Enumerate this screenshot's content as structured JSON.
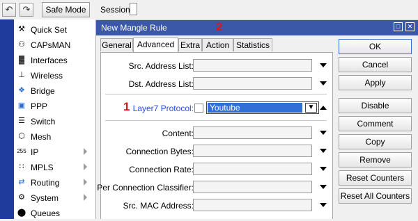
{
  "toolbar": {
    "undo_icon": "undo-icon",
    "redo_icon": "redo-icon",
    "safe_mode_label": "Safe Mode",
    "session_label": "Session:"
  },
  "sidebar": {
    "items": [
      {
        "label": "Quick Set",
        "icon": "quick-set-icon",
        "submenu": false
      },
      {
        "label": "CAPsMAN",
        "icon": "capsman-icon",
        "submenu": false
      },
      {
        "label": "Interfaces",
        "icon": "interfaces-icon",
        "submenu": false
      },
      {
        "label": "Wireless",
        "icon": "wireless-icon",
        "submenu": false
      },
      {
        "label": "Bridge",
        "icon": "bridge-icon",
        "submenu": false
      },
      {
        "label": "PPP",
        "icon": "ppp-icon",
        "submenu": false
      },
      {
        "label": "Switch",
        "icon": "switch-icon",
        "submenu": false
      },
      {
        "label": "Mesh",
        "icon": "mesh-icon",
        "submenu": false
      },
      {
        "label": "IP",
        "icon": "ip-icon",
        "submenu": true
      },
      {
        "label": "MPLS",
        "icon": "mpls-icon",
        "submenu": true
      },
      {
        "label": "Routing",
        "icon": "routing-icon",
        "submenu": true
      },
      {
        "label": "System",
        "icon": "system-icon",
        "submenu": true
      },
      {
        "label": "Queues",
        "icon": "queues-icon",
        "submenu": false
      }
    ]
  },
  "dialog": {
    "title": "New Mangle Rule",
    "marker_title": "2",
    "marker_field": "1",
    "tabs": [
      "General",
      "Advanced",
      "Extra",
      "Action",
      "Statistics"
    ],
    "active_tab": "Advanced",
    "fields": {
      "src_address_list": {
        "label": "Src. Address List:",
        "value": ""
      },
      "dst_address_list": {
        "label": "Dst. Address List:",
        "value": ""
      },
      "layer7_protocol": {
        "label": "Layer7 Protocol:",
        "value": "Youtube",
        "negate": false
      },
      "content": {
        "label": "Content:",
        "value": ""
      },
      "connection_bytes": {
        "label": "Connection Bytes:",
        "value": ""
      },
      "connection_rate": {
        "label": "Connection Rate:",
        "value": ""
      },
      "per_connection_classifier": {
        "label": "Per Connection Classifier:",
        "value": ""
      },
      "src_mac_address": {
        "label": "Src. MAC Address:",
        "value": ""
      }
    },
    "buttons": {
      "ok": "OK",
      "cancel": "Cancel",
      "apply": "Apply",
      "disable": "Disable",
      "comment": "Comment",
      "copy": "Copy",
      "remove": "Remove",
      "reset_counters": "Reset Counters",
      "reset_all_counters": "Reset All Counters"
    }
  },
  "colors": {
    "titlebar": "#3a57a8",
    "marker": "#d81818",
    "selection": "#2f6fd6",
    "layer7_label": "#2a4bd7"
  }
}
